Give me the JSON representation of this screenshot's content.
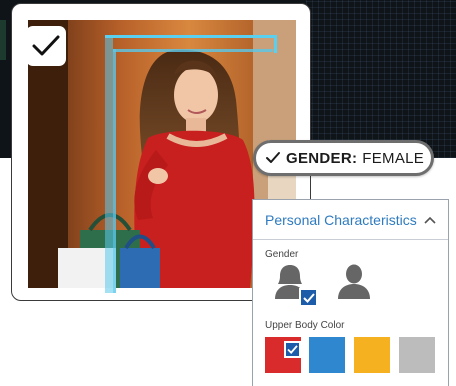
{
  "badge": {
    "label": "GENDER:",
    "value": "FEMALE"
  },
  "panel": {
    "title": "Personal Characteristics",
    "gender_label": "Gender",
    "gender_options": [
      {
        "icon": "female-user-icon",
        "selected": true
      },
      {
        "icon": "male-user-icon",
        "selected": false
      }
    ],
    "upper_body_label": "Upper Body Color",
    "upper_body_colors": [
      {
        "name": "red",
        "hex": "#d92b2b",
        "selected": true
      },
      {
        "name": "blue",
        "hex": "#2f88cf",
        "selected": false
      },
      {
        "name": "yellow",
        "hex": "#f5b120",
        "selected": false
      },
      {
        "name": "gray",
        "hex": "#bcbcbc",
        "selected": false
      }
    ]
  },
  "colors": {
    "accent": "#2e7bbf",
    "selection": "#1d5ca8",
    "detection": "#5ad0f0"
  }
}
